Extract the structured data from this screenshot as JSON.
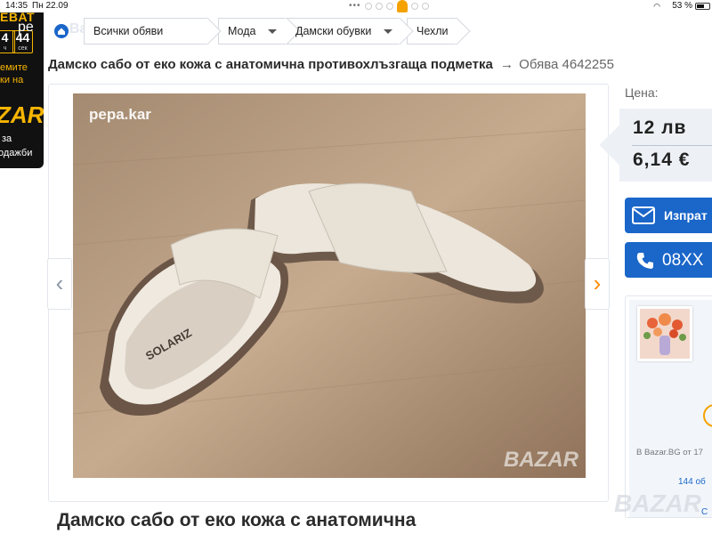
{
  "status_bar": {
    "time": "14:35",
    "date": "Пн 22.09",
    "battery": "53 %"
  },
  "promo": {
    "title": "ЕBAT",
    "countdown": [
      {
        "value": "4",
        "unit": "ч"
      },
      {
        "value": "44",
        "unit": "сек"
      }
    ],
    "line1": "емите",
    "line2": "ки на",
    "logo": "ZAR",
    "line3": "за",
    "line4": "одажби"
  },
  "header": {
    "site_logo": "pe",
    "ghost_logo": "Bazar"
  },
  "breadcrumb": {
    "items": [
      "Всички обяви",
      "Мода",
      "Дамски обувки",
      "Чехли"
    ]
  },
  "listing": {
    "title": "Дамско сабо от еко кожа с анатомична противохлъзгаща подметка",
    "arrow": "→",
    "ad_number": "Обява 4642255",
    "subtitle": "Дамско сабо от еко кожа с анатомична"
  },
  "gallery": {
    "watermark": "pepa.kar",
    "brand_mark": "BAZAR",
    "slide_count": 6,
    "active_slide": 4,
    "prev_glyph": "‹",
    "next_glyph": "›"
  },
  "price": {
    "label": "Цена:",
    "bgn": "12 лв",
    "eur": "6,14 €"
  },
  "actions": {
    "message_label": "Изпрат",
    "phone_label": "08XX"
  },
  "seller": {
    "since": "В Bazar.BG от 17",
    "ads_count": "144 об",
    "watermark": "BAZAR",
    "link": "С"
  },
  "colors": {
    "primary_blue": "#1a66c9",
    "accent_orange": "#f5a200",
    "price_bg": "#edf1f6"
  }
}
